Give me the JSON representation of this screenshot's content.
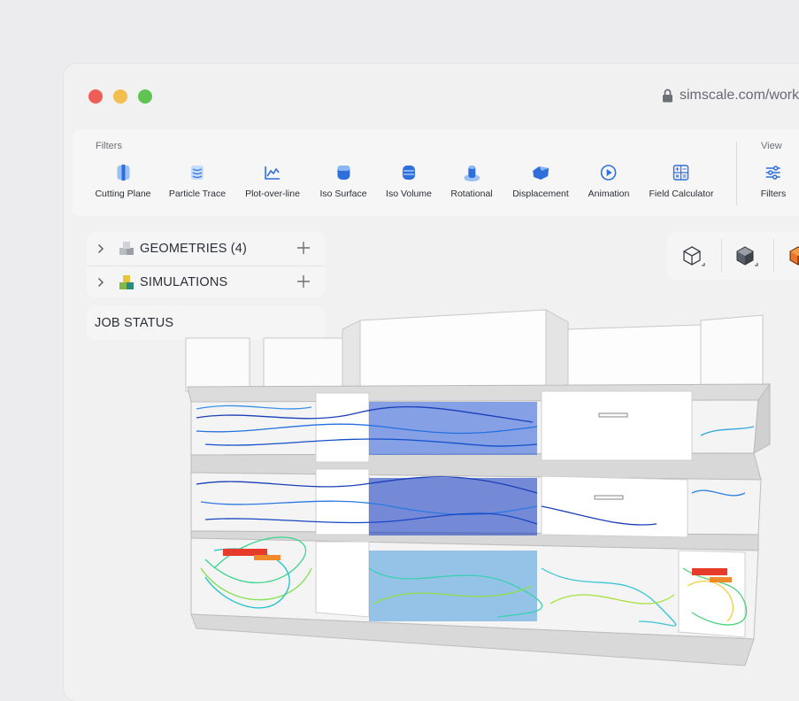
{
  "window": {
    "url": "simscale.com/work"
  },
  "ribbon": {
    "filters_group_label": "Filters",
    "view_group_label": "View",
    "tools": [
      {
        "label": "Cutting Plane",
        "icon": "cutting-plane-icon"
      },
      {
        "label": "Particle Trace",
        "icon": "particle-trace-icon"
      },
      {
        "label": "Plot-over-line",
        "icon": "plot-over-line-icon"
      },
      {
        "label": "Iso Surface",
        "icon": "iso-surface-icon"
      },
      {
        "label": "Iso Volume",
        "icon": "iso-volume-icon"
      },
      {
        "label": "Rotational",
        "icon": "rotational-icon"
      },
      {
        "label": "Displacement",
        "icon": "displacement-icon"
      },
      {
        "label": "Animation",
        "icon": "animation-icon"
      },
      {
        "label": "Field Calculator",
        "icon": "field-calculator-icon"
      }
    ],
    "view_tools": [
      {
        "label": "Filters",
        "icon": "filters-sliders-icon"
      }
    ]
  },
  "tree": {
    "geometries_label": "GEOMETRIES",
    "geometries_count": "(4)",
    "simulations_label": "SIMULATIONS",
    "job_status_label": "JOB STATUS"
  },
  "colors": {
    "accent": "#2f6fdc",
    "orange": "#e8762a",
    "close": "#ec5e57",
    "minimize": "#f4bd4f",
    "maximize": "#5fc454"
  }
}
